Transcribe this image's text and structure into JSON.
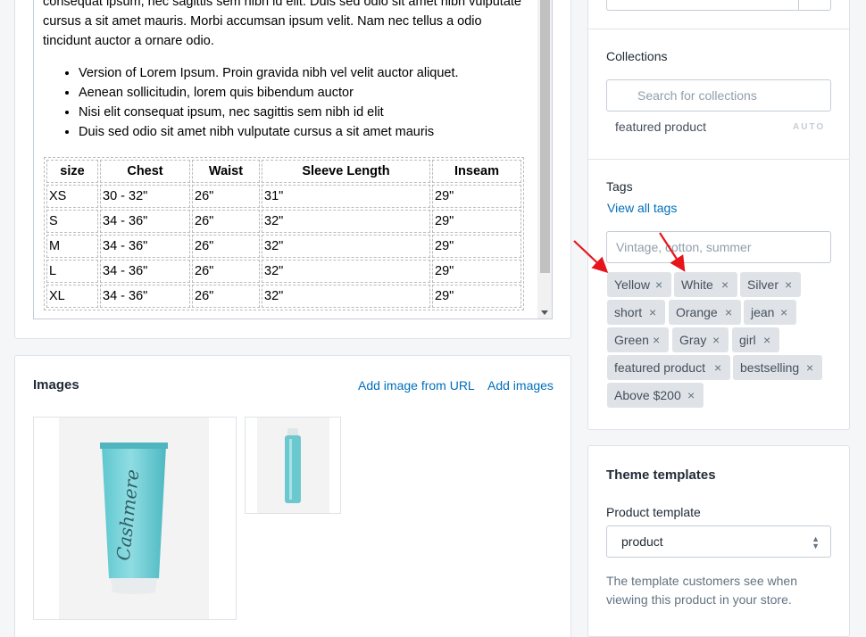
{
  "description": {
    "paragraph": "consequat ipsum, nec sagittis sem nibh id elit. Duis sed odio sit amet nibh vulputate cursus a sit amet mauris. Morbi accumsan ipsum velit. Nam nec tellus a odio tincidunt auctor a ornare odio.",
    "bullets": [
      "Version of Lorem Ipsum. Proin gravida nibh vel velit auctor aliquet.",
      "Aenean sollicitudin, lorem quis bibendum auctor",
      "Nisi elit consequat ipsum, nec sagittis sem nibh id elit",
      "Duis sed odio sit amet nibh vulputate cursus a sit amet mauris"
    ],
    "table": {
      "headers": [
        "size",
        "Chest",
        "Waist",
        "Sleeve Length",
        "Inseam"
      ],
      "rows": [
        [
          "XS",
          "30 - 32\"",
          "26\"",
          "31\"",
          "29\""
        ],
        [
          "S",
          "34 - 36\"",
          "26\"",
          "32\"",
          "29\""
        ],
        [
          "M",
          "34 - 36\"",
          "26\"",
          "32\"",
          "29\""
        ],
        [
          "L",
          "34 - 36\"",
          "26\"",
          "32\"",
          "29\""
        ],
        [
          "XL",
          "34 - 36\"",
          "26\"",
          "32\"",
          "29\""
        ]
      ]
    }
  },
  "images": {
    "title": "Images",
    "add_url_label": "Add image from URL",
    "add_images_label": "Add images",
    "product_brand_text": "Cashmere"
  },
  "collections": {
    "label": "Collections",
    "search_placeholder": "Search for collections",
    "items": [
      {
        "name": "featured product",
        "badge": "AUTO"
      }
    ]
  },
  "tags": {
    "label": "Tags",
    "view_all_label": "View all tags",
    "input_placeholder": "Vintage, cotton, summer",
    "remove_symbol": "×",
    "items": [
      "Yellow",
      "White",
      "Silver",
      "short",
      "Orange",
      "jean",
      "Green",
      "Gray",
      "girl",
      "featured product",
      "bestselling",
      "Above $200"
    ]
  },
  "theme": {
    "title": "Theme templates",
    "product_template_label": "Product template",
    "product_template_value": "product",
    "help_text": "The template customers see when viewing this product in your store."
  },
  "colors": {
    "link": "#006fbb",
    "tag_bg": "#dfe3e8",
    "annotation_arrow": "#e8141c"
  }
}
